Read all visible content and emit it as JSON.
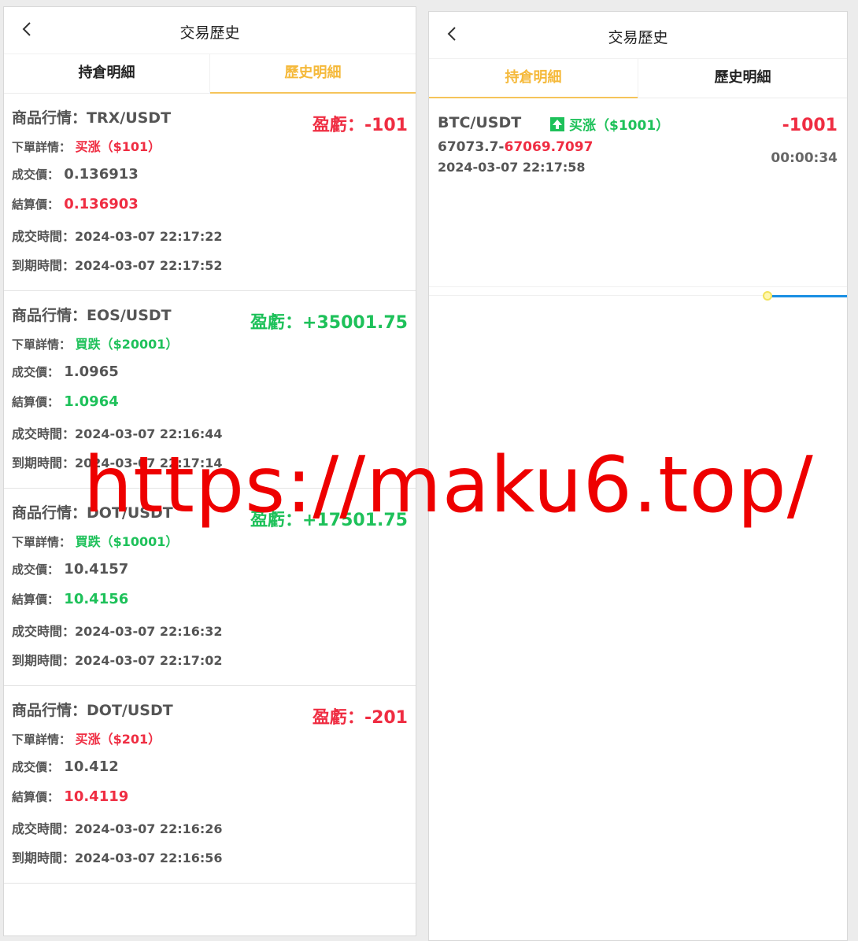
{
  "left": {
    "title": "交易歷史",
    "tabs": [
      {
        "label": "持倉明細",
        "active": false
      },
      {
        "label": "歷史明細",
        "active": true
      }
    ],
    "labels": {
      "product": "商品行情：",
      "order": "下單詳情：",
      "deal_price": "成交價：",
      "settle_price": "結算價：",
      "deal_time": "成交時間：",
      "expire_time": "到期時間：",
      "pnl": "盈虧："
    },
    "records": [
      {
        "pair": "TRX/USDT",
        "direction": "买涨（$101）",
        "deal_price": "0.136913",
        "settle_price": "0.136903",
        "deal_time": "2024-03-07 22:17:22",
        "expire_time": "2024-03-07 22:17:52",
        "pnl": "-101",
        "color": "#ef2d42"
      },
      {
        "pair": "EOS/USDT",
        "direction": "買跌（$20001）",
        "deal_price": "1.0965",
        "settle_price": "1.0964",
        "deal_time": "2024-03-07 22:16:44",
        "expire_time": "2024-03-07 22:17:14",
        "pnl": "+35001.75",
        "color": "#1ec15a"
      },
      {
        "pair": "DOT/USDT",
        "direction": "買跌（$10001）",
        "deal_price": "10.4157",
        "settle_price": "10.4156",
        "deal_time": "2024-03-07 22:16:32",
        "expire_time": "2024-03-07 22:17:02",
        "pnl": "+17501.75",
        "color": "#1ec15a"
      },
      {
        "pair": "DOT/USDT",
        "direction": "买涨（$201）",
        "deal_price": "10.412",
        "settle_price": "10.4119",
        "deal_time": "2024-03-07 22:16:26",
        "expire_time": "2024-03-07 22:16:56",
        "pnl": "-201",
        "color": "#ef2d42"
      }
    ]
  },
  "right": {
    "title": "交易歷史",
    "tabs": [
      {
        "label": "持倉明細",
        "active": true
      },
      {
        "label": "歷史明細",
        "active": false
      }
    ],
    "position": {
      "pair": "BTC/USDT",
      "direction": "买涨（$1001）",
      "pnl": "-1001",
      "open_price": "67073.7-",
      "current_price": "67069.7097",
      "time": "2024-03-07 22:17:58",
      "countdown": "00:00:34",
      "progress": 0.19
    }
  },
  "watermark": "https://maku6.top/",
  "colors": {
    "accent": "#f5b93a",
    "up": "#ef2d42",
    "down": "#1ec15a",
    "bar": "#1a8fe3"
  }
}
